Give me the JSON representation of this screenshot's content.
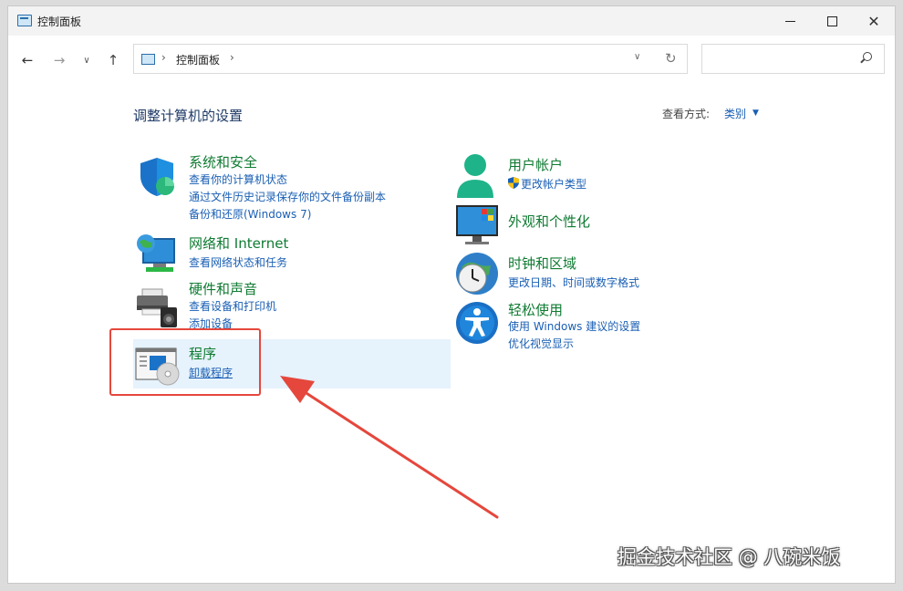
{
  "window": {
    "title": "控制面板"
  },
  "address": {
    "path_label": "控制面板",
    "search_placeholder": ""
  },
  "header": {
    "title": "调整计算机的设置",
    "view_label": "查看方式:",
    "view_value": "类别"
  },
  "categories": {
    "system_security": {
      "title": "系统和安全",
      "links": [
        "查看你的计算机状态",
        "通过文件历史记录保存你的文件备份副本",
        "备份和还原(Windows 7)"
      ]
    },
    "network": {
      "title": "网络和 Internet",
      "links": [
        "查看网络状态和任务"
      ]
    },
    "hardware": {
      "title": "硬件和声音",
      "links": [
        "查看设备和打印机",
        "添加设备"
      ]
    },
    "programs": {
      "title": "程序",
      "links": [
        "卸载程序"
      ]
    },
    "user_accounts": {
      "title": "用户帐户",
      "links": [
        "更改帐户类型"
      ]
    },
    "appearance": {
      "title": "外观和个性化",
      "links": []
    },
    "clock_region": {
      "title": "时钟和区域",
      "links": [
        "更改日期、时间或数字格式"
      ]
    },
    "ease_of_access": {
      "title": "轻松使用",
      "links": [
        "使用 Windows 建议的设置",
        "优化视觉显示"
      ]
    }
  },
  "watermark": "掘金技术社区 @ 八碗米饭",
  "colors": {
    "category_title": "#0f7b32",
    "link": "#1a5fb4",
    "annotation": "#e5473c",
    "highlight": "#e6f2fc"
  }
}
